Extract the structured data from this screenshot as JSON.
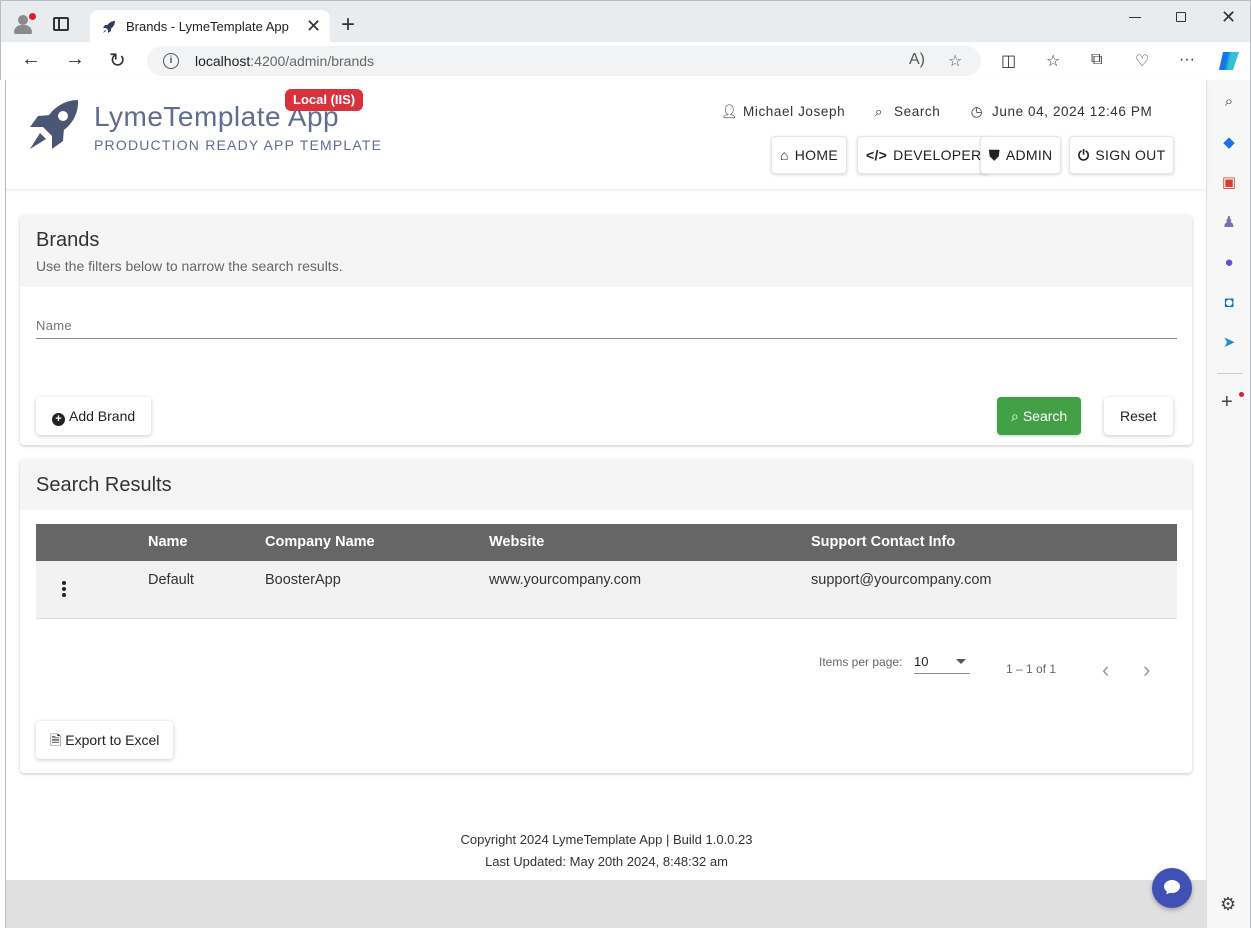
{
  "browser": {
    "tab_title": "Brands - LymeTemplate App",
    "url_host": "localhost",
    "url_rest": ":4200/admin/brands"
  },
  "app": {
    "name": "LymeTemplate App",
    "tagline": "PRODUCTION READY APP TEMPLATE",
    "env_badge": "Local (IIS)"
  },
  "header": {
    "user": "Michael Joseph",
    "search": "Search",
    "datetime": "June 04, 2024 12:46 PM",
    "nav": {
      "home": "HOME",
      "developer": "DEVELOPER",
      "admin": "ADMIN",
      "signout": "SIGN OUT"
    }
  },
  "filters": {
    "title": "Brands",
    "subtitle": "Use the filters below to narrow the search results.",
    "name_label": "Name",
    "add_button": "Add Brand",
    "search_button": "Search",
    "reset_button": "Reset"
  },
  "results": {
    "title": "Search Results",
    "columns": {
      "name": "Name",
      "company": "Company Name",
      "website": "Website",
      "support": "Support Contact Info"
    },
    "rows": [
      {
        "name": "Default",
        "company": "BoosterApp",
        "website": "www.yourcompany.com",
        "support": "support@yourcompany.com"
      }
    ],
    "pager": {
      "label": "Items per page:",
      "page_size": "10",
      "range": "1 – 1 of 1"
    },
    "export_button": "Export to Excel"
  },
  "footer": {
    "line1": "Copyright 2024 LymeTemplate App | Build 1.0.0.23",
    "line2": "Last Updated: May 20th 2024, 8:48:32 am"
  },
  "colors": {
    "brand": "#5e6d90",
    "badge": "#d9323f",
    "search_green": "#43a047",
    "table_header": "#666666",
    "chat_fab": "#3f51b5"
  }
}
